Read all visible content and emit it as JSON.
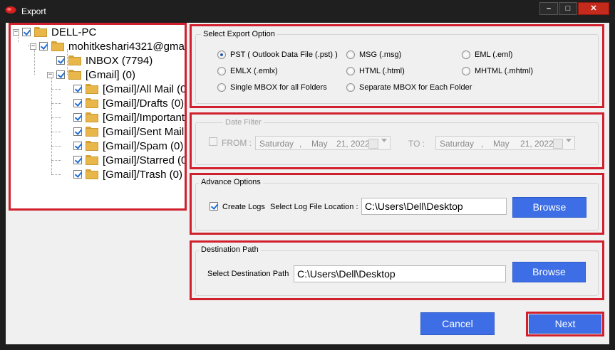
{
  "window": {
    "title": "Export",
    "minimize_glyph": "–",
    "maximize_glyph": "□",
    "close_glyph": "✕"
  },
  "tree": {
    "root": "DELL-PC",
    "account": "mohitkeshari4321@gma",
    "folders": [
      "INBOX (7794)",
      "[Gmail] (0)",
      "[Gmail]/All Mail (0",
      "[Gmail]/Drafts (0)",
      "[Gmail]/Important",
      "[Gmail]/Sent Mail",
      "[Gmail]/Spam (0)",
      "[Gmail]/Starred (0",
      "[Gmail]/Trash (0)"
    ]
  },
  "export_option": {
    "legend": "Select Export Option",
    "options": [
      "PST ( Outlook Data File (.pst) )",
      "MSG  (.msg)",
      "EML  (.eml)",
      "EMLX  (.emlx)",
      "HTML  (.html)",
      "MHTML  (.mhtml)",
      "Single MBOX for all Folders",
      "Separate MBOX for Each Folder"
    ],
    "selected": "PST ( Outlook Data File (.pst) )"
  },
  "date_filter": {
    "legend": "Date Filter",
    "from_label": "FROM :",
    "to_label": "TO :",
    "from": {
      "day": "Saturday",
      "sep": ",",
      "month": "May",
      "date": "21, 2022"
    },
    "to": {
      "day": "Saturday",
      "sep": ",",
      "month": "May",
      "date": "21, 2022"
    }
  },
  "advance_options": {
    "legend": "Advance Options",
    "create_logs_label": "Create Logs",
    "log_location_label": "Select Log File Location :",
    "log_path": "C:\\Users\\Dell\\Desktop",
    "browse_label": "Browse"
  },
  "destination": {
    "legend": "Destination Path",
    "label": "Select Destination Path",
    "path": "C:\\Users\\Dell\\Desktop",
    "browse_label": "Browse"
  },
  "footer": {
    "cancel_label": "Cancel",
    "next_label": "Next"
  },
  "colors": {
    "highlight": "#d0202e",
    "button_blue": "#3d6ee6"
  }
}
